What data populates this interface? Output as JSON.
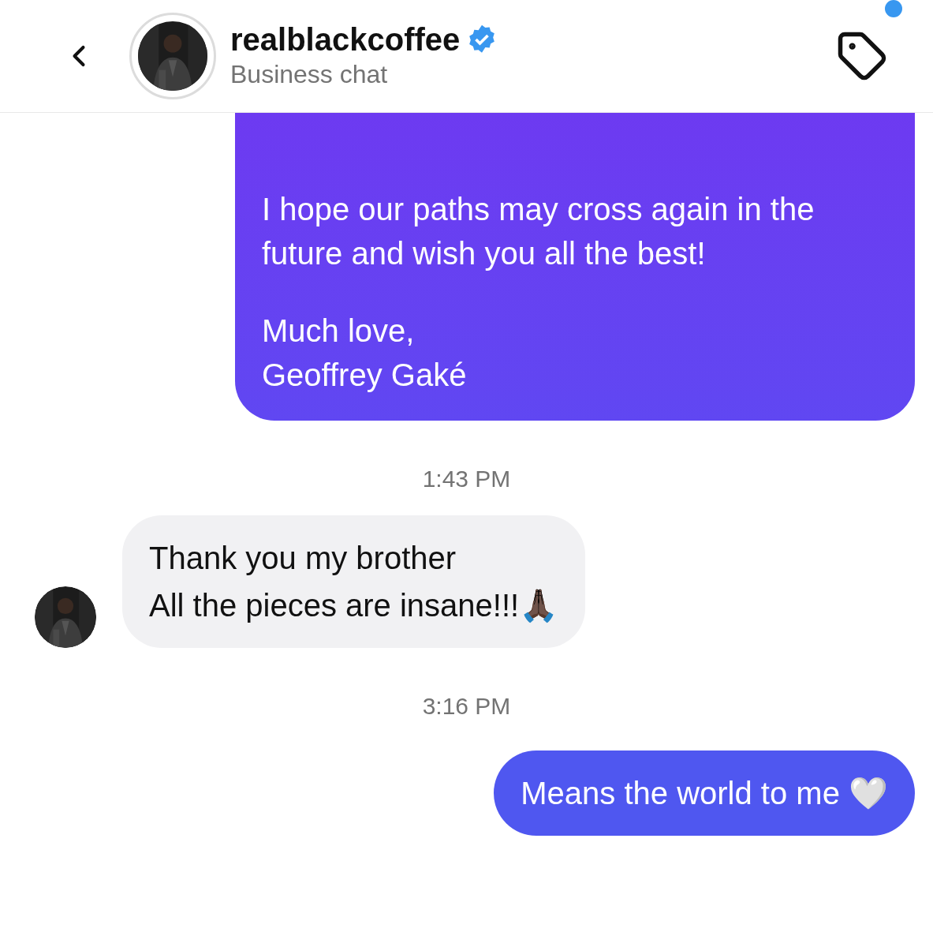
{
  "header": {
    "username": "realblackcoffee",
    "verified": true,
    "subtitle": "Business chat",
    "tag_unread": true
  },
  "messages": [
    {
      "kind": "sent",
      "paragraphs": [
        [
          "I hope our paths may cross again in the",
          "future and wish you all the best!"
        ],
        [
          "Much love,",
          "Geoffrey Gaké"
        ]
      ],
      "cut_top": true
    },
    {
      "kind": "time",
      "text": "1:43 PM"
    },
    {
      "kind": "received",
      "paragraphs": [
        [
          "Thank you my brother",
          "All the pieces are insane!!!🙏🏿"
        ]
      ]
    },
    {
      "kind": "time",
      "text": "3:16 PM"
    },
    {
      "kind": "sent_short",
      "paragraphs": [
        [
          "Means the world to me 🤍"
        ]
      ]
    }
  ]
}
